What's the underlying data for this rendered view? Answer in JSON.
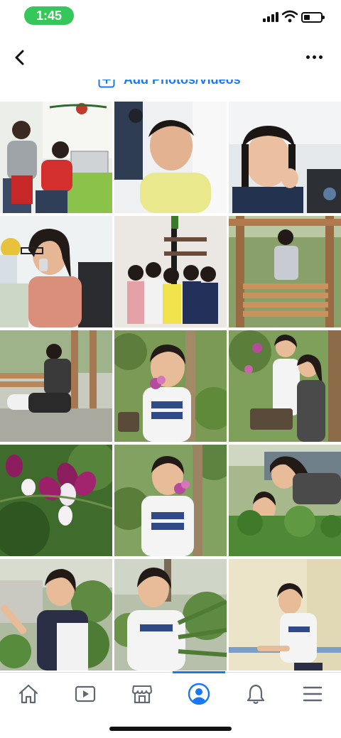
{
  "status_bar": {
    "time": "1:45",
    "time_pill_color": "#34c759"
  },
  "header": {
    "back_icon": "chevron-left-icon",
    "more_icon": "more-horizontal-icon"
  },
  "add_photos": {
    "label": "Add Photos/Videos",
    "icon": "add-photo-icon",
    "color": "#1877f2"
  },
  "photo_grid": {
    "photos": [
      {
        "desc": "office-two-men-laptop",
        "bg": "#e8ebe6"
      },
      {
        "desc": "young-man-yellow-shirt",
        "bg": "#eceef0"
      },
      {
        "desc": "woman-hand-on-cheek",
        "bg": "#dde1e4"
      },
      {
        "desc": "woman-on-phone-office",
        "bg": "#eef1f2"
      },
      {
        "desc": "group-five-women",
        "bg": "#e9e6e2"
      },
      {
        "desc": "woman-wooden-swing",
        "bg": "#8aa06a"
      },
      {
        "desc": "couple-on-bench",
        "bg": "#c8ccc0"
      },
      {
        "desc": "woman-with-orchid",
        "bg": "#7b9a56"
      },
      {
        "desc": "two-women-orchids",
        "bg": "#7fa05a"
      },
      {
        "desc": "purple-orchid-closeup",
        "bg": "#3f6b2c"
      },
      {
        "desc": "woman-orchid-garden",
        "bg": "#82a262"
      },
      {
        "desc": "two-women-plants",
        "bg": "#9cb07e"
      },
      {
        "desc": "woman-peace-sign",
        "bg": "#a9b79b"
      },
      {
        "desc": "woman-palm-leaves",
        "bg": "#b6c0aa"
      },
      {
        "desc": "woman-leaning-railing",
        "bg": "#e8e2c8"
      }
    ]
  },
  "bottom_nav": {
    "items": [
      {
        "icon": "home-icon"
      },
      {
        "icon": "watch-video-icon"
      },
      {
        "icon": "marketplace-store-icon"
      },
      {
        "icon": "profile-icon"
      },
      {
        "icon": "notifications-bell-icon"
      },
      {
        "icon": "menu-icon"
      }
    ],
    "active_index": 3,
    "active_color": "#1877f2"
  }
}
